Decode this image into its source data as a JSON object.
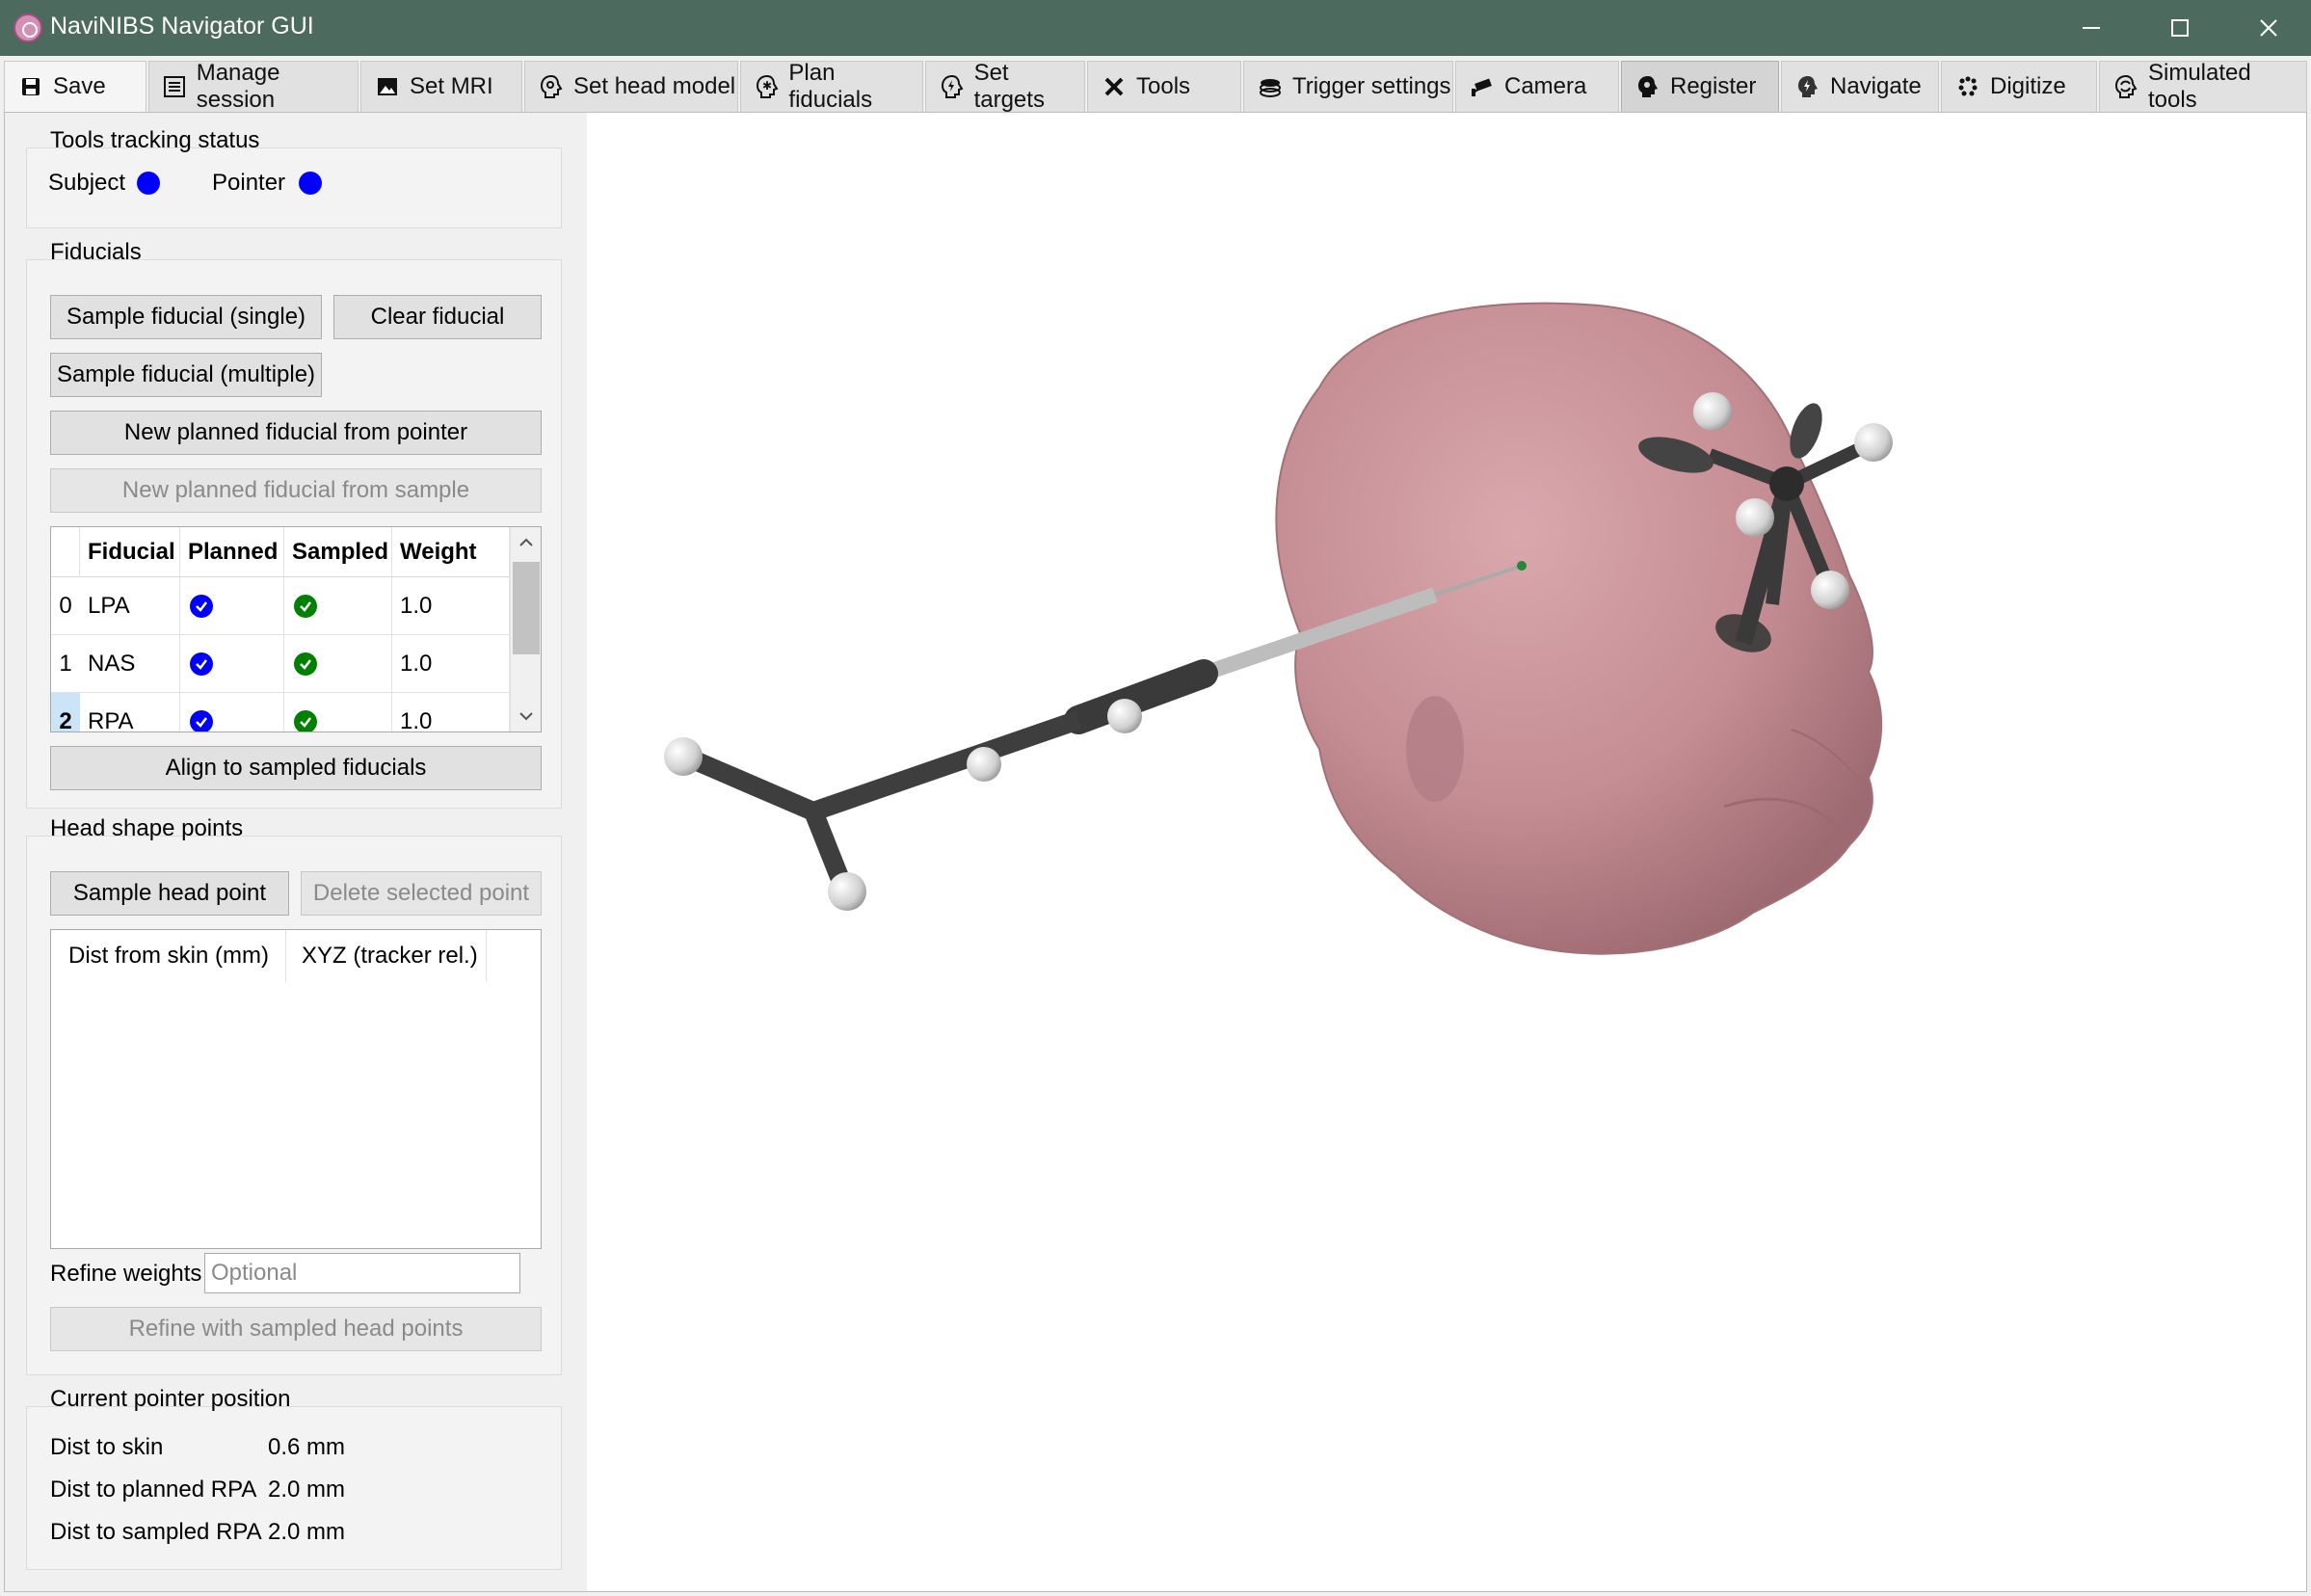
{
  "window": {
    "title": "NaviNIBS Navigator GUI",
    "minimize": "—",
    "maximize": "☐",
    "close": "✕"
  },
  "tabs": [
    {
      "label": "Save",
      "icon": "floppy-icon"
    },
    {
      "label": "Manage session",
      "icon": "list-icon"
    },
    {
      "label": "Set MRI",
      "icon": "image-icon"
    },
    {
      "label": "Set head model",
      "icon": "head-icon"
    },
    {
      "label": "Plan fiducials",
      "icon": "head-star-icon"
    },
    {
      "label": "Set targets",
      "icon": "head-bolt-icon"
    },
    {
      "label": "Tools",
      "icon": "tools-icon"
    },
    {
      "label": "Trigger settings",
      "icon": "layers-icon"
    },
    {
      "label": "Camera",
      "icon": "cctv-icon"
    },
    {
      "label": "Register",
      "icon": "head-cog-icon"
    },
    {
      "label": "Navigate",
      "icon": "head-bolt-icon"
    },
    {
      "label": "Digitize",
      "icon": "dots-icon"
    },
    {
      "label": "Simulated tools",
      "icon": "head-sync-icon"
    }
  ],
  "active_tab": "Register",
  "tracking": {
    "title": "Tools tracking status",
    "subject_label": "Subject",
    "pointer_label": "Pointer",
    "status_color": "#0000ff"
  },
  "fiducials": {
    "title": "Fiducials",
    "sample_single": "Sample fiducial (single)",
    "clear": "Clear fiducial",
    "sample_multiple": "Sample fiducial (multiple)",
    "new_from_pointer": "New planned fiducial from pointer",
    "new_from_sample": "New planned fiducial from sample",
    "table": {
      "columns": [
        "Fiducial",
        "Planned",
        "Sampled",
        "Weight"
      ],
      "rows": [
        {
          "index": "0",
          "name": "LPA",
          "weight": "1.0"
        },
        {
          "index": "1",
          "name": "NAS",
          "weight": "1.0"
        },
        {
          "index": "2",
          "name": "RPA",
          "weight": "1.0"
        }
      ]
    },
    "align": "Align to sampled fiducials"
  },
  "head_shape": {
    "title": "Head shape points",
    "sample": "Sample head point",
    "delete": "Delete selected point",
    "columns": [
      "Dist from skin (mm)",
      "XYZ (tracker rel.)"
    ],
    "refine_label": "Refine weights",
    "refine_placeholder": "Optional",
    "refine_button": "Refine with sampled head points"
  },
  "pointer_position": {
    "title": "Current pointer position",
    "dist_skin_label": "Dist to skin",
    "dist_skin_value": "0.6 mm",
    "dist_planned_label": "Dist to planned RPA",
    "dist_planned_value": "2.0 mm",
    "dist_sampled_label": "Dist to sampled RPA",
    "dist_sampled_value": "2.0 mm"
  },
  "colors": {
    "titlebar": "#4c6b5e",
    "head_skin": "#c9959b",
    "tool_dark": "#3a3a3a",
    "planned_check": "#0000ff",
    "sampled_check": "#008000"
  }
}
